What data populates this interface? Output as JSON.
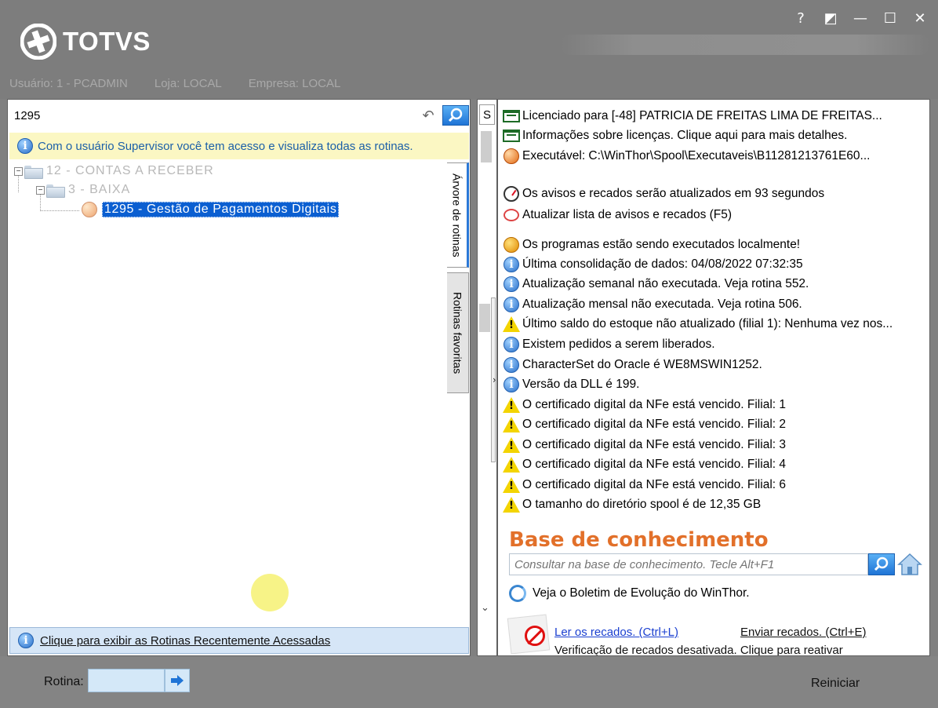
{
  "header": {
    "logo_text": "TOTVS",
    "window_controls": [
      "?",
      "◩",
      "—",
      "☐",
      "✕"
    ],
    "usuario": "Usuário: 1 - PCADMIN",
    "loja": "Loja: LOCAL",
    "empresa": "Empresa: LOCAL"
  },
  "left": {
    "search_value": "1295",
    "notice": "Com o usuário Supervisor você tem acesso e visualiza todas as rotinas.",
    "tree": {
      "node1": "12 - CONTAS A RECEBER",
      "node2": "3 - BAIXA",
      "node3": "1295 - Gestão de Pagamentos Digitais"
    },
    "tabs": [
      "Árvore de rotinas",
      "Rotinas favoritas"
    ],
    "recent_link": "Clique para exibir as Rotinas Recentemente Acessadas"
  },
  "middle": {
    "top_letter": "S"
  },
  "right": {
    "messages": [
      {
        "icon": "license-icon",
        "text": "Licenciado para [-48] PATRICIA DE FREITAS LIMA DE FREITAS..."
      },
      {
        "icon": "license-icon",
        "text": "Informações sobre licenças. Clique aqui para mais detalhes."
      },
      {
        "icon": "executable-icon",
        "text": "Executável: C:\\WinThor\\Spool\\Executaveis\\B11281213761E60..."
      },
      {
        "icon": "clock-icon",
        "text": "Os avisos e recados serão atualizados em 93 segundos"
      },
      {
        "icon": "refresh-icon",
        "text": "Atualizar lista de avisos e recados (F5)"
      },
      {
        "icon": "local-exec-icon",
        "text": "Os programas estão sendo executados localmente!"
      },
      {
        "icon": "info-icon",
        "text": "Última consolidação de dados: 04/08/2022 07:32:35"
      },
      {
        "icon": "info-icon",
        "text": "Atualização semanal não executada. Veja rotina 552."
      },
      {
        "icon": "info-icon",
        "text": "Atualização mensal não executada. Veja rotina 506."
      },
      {
        "icon": "warning-icon",
        "text": "Último saldo do estoque não atualizado (filial 1): Nenhuma vez nos..."
      },
      {
        "icon": "info-icon",
        "text": "Existem pedidos a serem liberados."
      },
      {
        "icon": "info-icon",
        "text": "CharacterSet do Oracle é WE8MSWIN1252."
      },
      {
        "icon": "info-icon",
        "text": "Versão da DLL é 199."
      },
      {
        "icon": "warning-icon",
        "text": "O certificado digital da NFe está vencido. Filial: 1"
      },
      {
        "icon": "warning-icon",
        "text": "O certificado digital da NFe está vencido. Filial: 2"
      },
      {
        "icon": "warning-icon",
        "text": "O certificado digital da NFe está vencido. Filial: 3"
      },
      {
        "icon": "warning-icon",
        "text": "O certificado digital da NFe está vencido. Filial: 4"
      },
      {
        "icon": "warning-icon",
        "text": "O certificado digital da NFe está vencido. Filial: 6"
      },
      {
        "icon": "warning-icon",
        "text": "O tamanho do diretório spool é de 12,35 GB"
      }
    ],
    "kb_title": "Base de conhecimento",
    "kb_placeholder": "Consultar na base de conhecimento. Tecle Alt+F1",
    "boletim": "Veja o Boletim de Evolução do WinThor.",
    "ler_recados": "Ler os recados. (Ctrl+L)",
    "enviar_recados": "Enviar recados. (Ctrl+E)",
    "verificacao": "Verificação de recados desativada. Clique para reativar"
  },
  "bottom": {
    "rotina_label": "Rotina:",
    "rotina_value": "",
    "reiniciar": "Reiniciar"
  },
  "colors": {
    "header_bg": "#7d7d7d",
    "notice_bg": "#fbf7c3",
    "selection": "#0b5fd1",
    "kb_title": "#e2702a",
    "link": "#1a3fd0"
  }
}
